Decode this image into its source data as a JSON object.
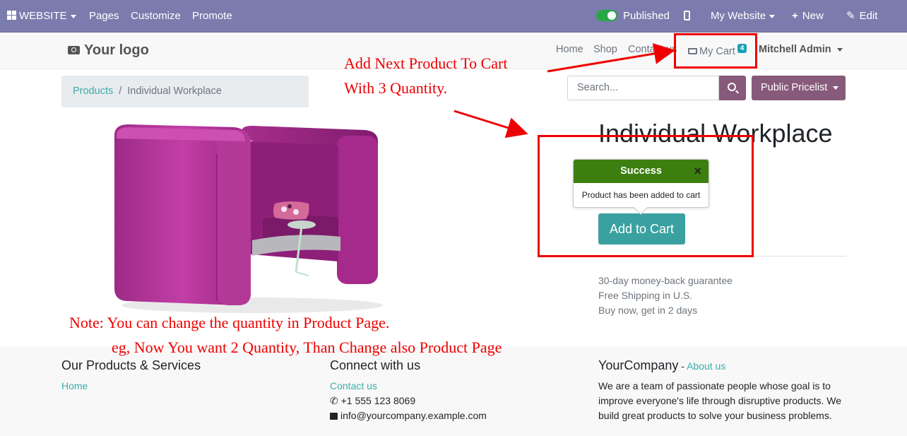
{
  "adminbar": {
    "website_label": "WEBSITE",
    "menu": [
      "Pages",
      "Customize",
      "Promote"
    ],
    "published_label": "Published",
    "my_website_label": "My Website",
    "new_label": "New",
    "edit_label": "Edit",
    "color": "#7c7bad"
  },
  "header": {
    "logo_text": "Your logo",
    "nav": [
      "Home",
      "Shop",
      "Contact us"
    ],
    "cart_label": "My Cart",
    "cart_count": "4",
    "user_label": "Mitchell Admin"
  },
  "breadcrumb": {
    "parent": "Products",
    "sep": "/",
    "current": "Individual Workplace"
  },
  "search": {
    "placeholder": "Search..."
  },
  "pricelist_label": "Public Pricelist",
  "product": {
    "title": "Individual Workplace",
    "add_to_cart_label": "Add to Cart",
    "guarantees": [
      "30-day money-back guarantee",
      "Free Shipping in U.S.",
      "Buy now, get in 2 days"
    ],
    "image_icon": "purple-booth-sofa-image"
  },
  "popover": {
    "title": "Success",
    "close": "×",
    "message": "Product has been added to cart",
    "color": "#3c7f0e"
  },
  "annotations": {
    "line1": "Add Next Product To Cart",
    "line2": "With 3 Quantity.",
    "note1": "Note: You can change the quantity in Product Page.",
    "note2": "eg, Now You want 2 Quantity, Than Change also Product Page",
    "color": "#ee0000"
  },
  "footer": {
    "col1_title": "Our Products & Services",
    "col1_link": "Home",
    "col2_title": "Connect with us",
    "col2_link": "Contact us",
    "phone": "+1 555 123 8069",
    "email": "info@yourcompany.example.com",
    "col3_title": "YourCompany",
    "col3_dash": " - ",
    "col3_link": "About us",
    "about_lines": [
      "We are a team of passionate people whose goal is to",
      "improve everyone's life through disruptive products. We",
      "build great products to solve your business problems."
    ]
  }
}
